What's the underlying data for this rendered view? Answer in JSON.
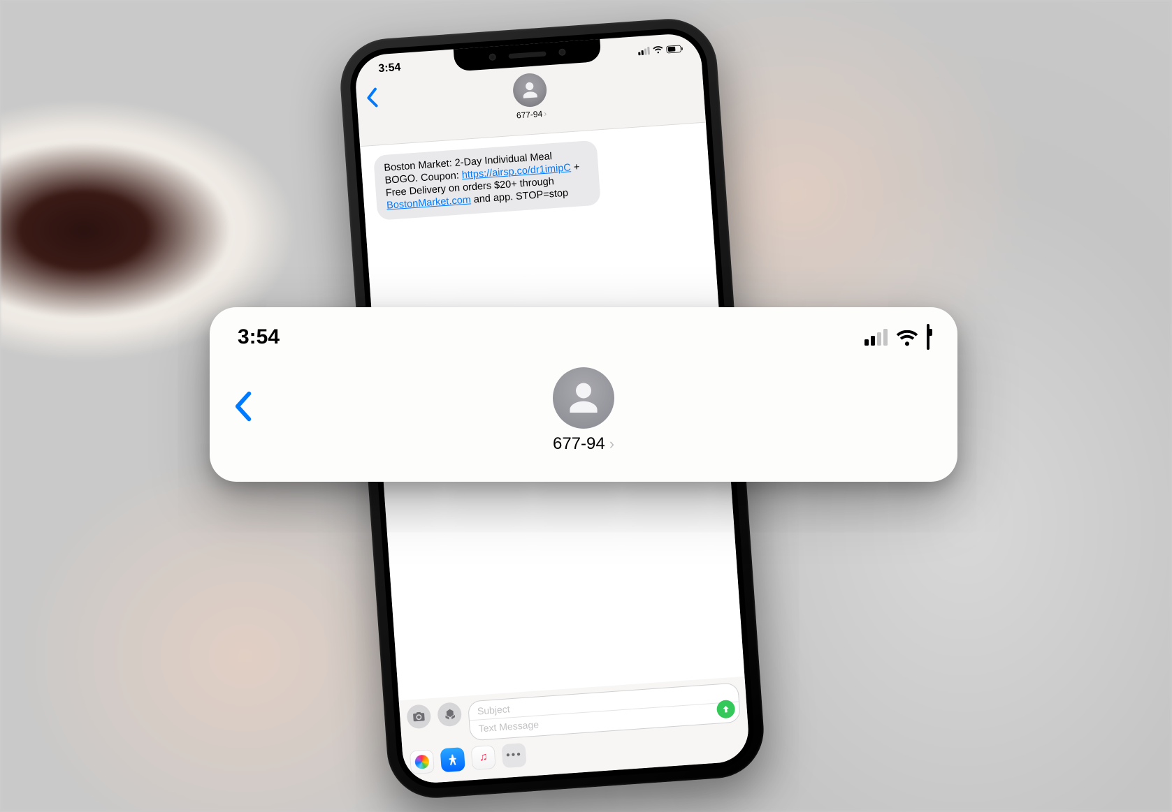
{
  "status": {
    "time": "3:54"
  },
  "contact": {
    "name": "677-94"
  },
  "message": {
    "text_prefix": "Boston Market: 2-Day Individual Meal BOGO. Coupon: ",
    "link1": "https://airsp.co/dr1imipC",
    "text_mid": " + Free Delivery on orders $20+ through ",
    "link2": "BostonMarket.com",
    "text_suffix": " and app. STOP=stop"
  },
  "compose": {
    "subject_placeholder": "Subject",
    "message_placeholder": "Text Message"
  },
  "callout": {
    "time": "3:54",
    "contact_name": "677-94"
  }
}
